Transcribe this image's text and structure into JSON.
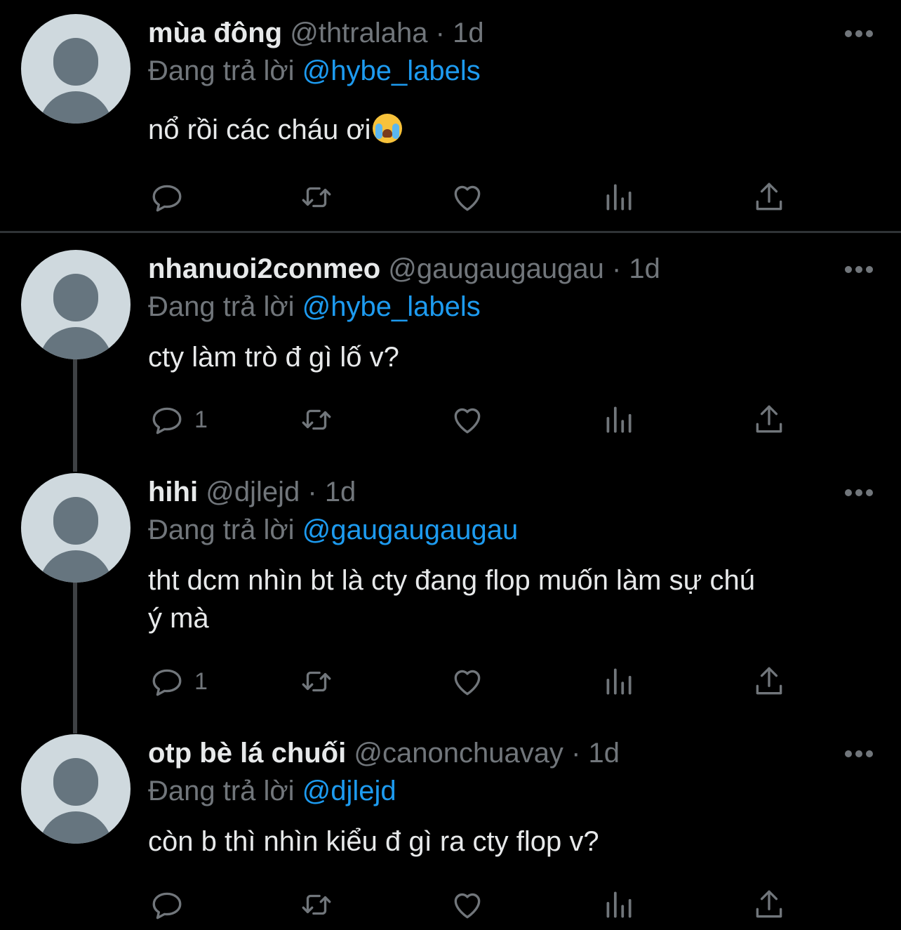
{
  "tweets": [
    {
      "name": "mùa đông",
      "handle": "@thtralaha",
      "dot": "·",
      "time": "1d",
      "reply_prefix": "Đang trả lời",
      "reply_to": "@hybe_labels",
      "text": "nổ rồi các cháu ơi",
      "emoji": "loudly-crying-face-emoji",
      "reply_count": ""
    },
    {
      "name": "nhanuoi2conmeo",
      "handle": "@gaugaugaugau",
      "dot": "·",
      "time": "1d",
      "reply_prefix": "Đang trả lời",
      "reply_to": "@hybe_labels",
      "text": "cty làm trò đ gì lố v?",
      "reply_count": "1"
    },
    {
      "name": "hihi",
      "handle": "@djlejd",
      "dot": "·",
      "time": "1d",
      "reply_prefix": "Đang trả lời",
      "reply_to": "@gaugaugaugau",
      "text_line1": "tht dcm nhìn bt là cty đang flop muốn làm sự chú",
      "text_line2": "ý mà",
      "reply_count": "1"
    },
    {
      "name": "otp bè lá chuối",
      "handle": "@canonchuavay",
      "dot": "·",
      "time": "1d",
      "reply_prefix": "Đang trả lời",
      "reply_to": "@djlejd",
      "text": "còn b thì nhìn kiểu đ gì ra cty flop v?",
      "reply_count": ""
    }
  ],
  "icons": {
    "reply": "reply-icon",
    "retweet": "retweet-icon",
    "like": "heart-icon",
    "views": "analytics-icon",
    "share": "share-icon",
    "more": "more-icon",
    "avatar": "default-avatar"
  },
  "colors": {
    "background": "#000000",
    "primary_text": "#e7e9ea",
    "secondary_text": "#71767b",
    "link": "#1d9bf0",
    "divider": "#2f3336",
    "thread_line": "#3e4144"
  }
}
